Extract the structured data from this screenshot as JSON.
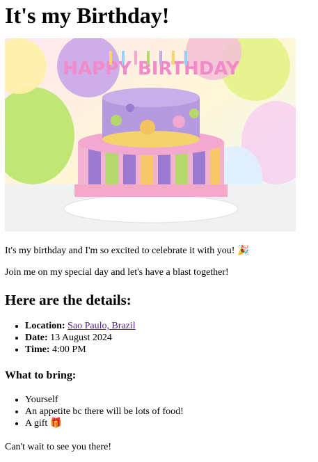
{
  "page": {
    "title": "It's my Birthday!",
    "hero_alt": "Birthday cake",
    "intro": "It's my birthday and I'm so excited to celebrate it with you! 🎉",
    "invite": "Join me on my special day and let's have a blast together!",
    "details_heading": "Here are the details:",
    "details": [
      {
        "label": "Location:",
        "value": "Sao Paulo, Brazil",
        "is_link": true
      },
      {
        "label": "Date:",
        "value": "13 August 2024"
      },
      {
        "label": "Time:",
        "value": "4:00 PM"
      }
    ],
    "bring_heading": "What to bring:",
    "bring": [
      "Yourself",
      "An appetite bc there will be lots of food!",
      "A gift 🎁"
    ],
    "outro": "Can't wait to see you there!",
    "cake_text": "HAPPY BIRTHDAY"
  },
  "colors": {
    "link": "#551a8b"
  }
}
